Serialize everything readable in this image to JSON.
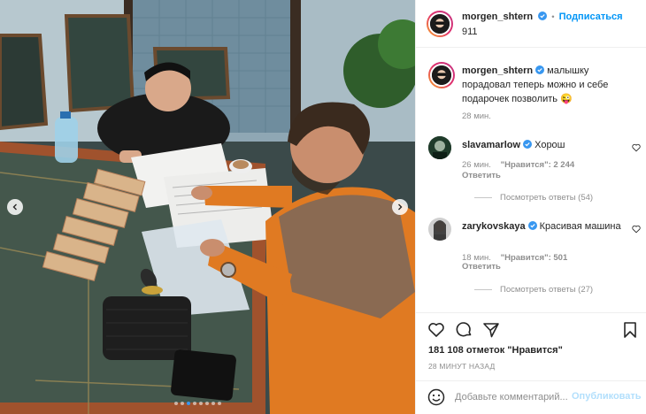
{
  "post": {
    "author": "morgen_shtern",
    "follow_label": "Подписаться",
    "separator": "•",
    "subtitle": "911",
    "caption_author": "morgen_shtern",
    "caption_text": "малышку порадовал теперь можно и себе подарочек позволить 😜",
    "caption_time": "28 мин."
  },
  "comments": [
    {
      "user": "slavamarlow",
      "text": "Хорош",
      "time": "26 мин.",
      "likes": "\"Нравится\": 2 244",
      "reply": "Ответить",
      "view_replies": "Посмотреть ответы (54)"
    },
    {
      "user": "zarykovskaya",
      "text": "Красивая машина",
      "time": "18 мин.",
      "likes": "\"Нравится\": 501",
      "reply": "Ответить",
      "view_replies": "Посмотреть ответы (27)"
    }
  ],
  "actions": {
    "icons": [
      "heart-icon",
      "comment-icon",
      "share-icon",
      "bookmark-icon"
    ],
    "likes_text": "181 108 отметок \"Нравится\"",
    "time_ago": "28 МИНУТ НАЗАД"
  },
  "add_comment": {
    "placeholder": "Добавьте комментарий...",
    "publish_label": "Опубликовать"
  },
  "carousel": {
    "total": 8,
    "active_index": 2
  },
  "colors": {
    "accent": "#0095f6",
    "verified": "#3897f0",
    "muted": "#8e8e8e",
    "publish_disabled": "#b2dffc"
  }
}
